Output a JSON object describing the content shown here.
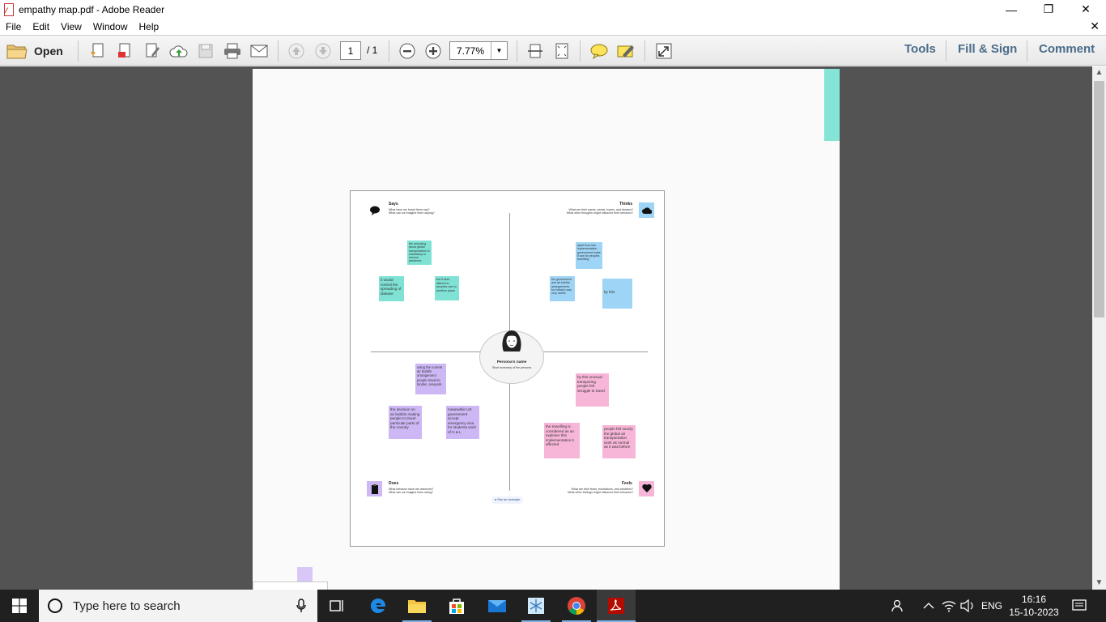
{
  "window": {
    "title": "empathy map.pdf - Adobe Reader",
    "minimize": "—",
    "restore": "❐",
    "close": "✕"
  },
  "menu": {
    "items": [
      "File",
      "Edit",
      "View",
      "Window",
      "Help"
    ],
    "close_doc": "✕"
  },
  "toolbar": {
    "open_label": "Open",
    "page_current": "1",
    "page_total": "/ 1",
    "zoom_value": "7.77%",
    "tools_label": "Tools",
    "fillsign_label": "Fill & Sign",
    "comment_label": "Comment"
  },
  "empathy_map": {
    "says": {
      "title": "Says",
      "subtitle": "What have we heard them say?\nWhat can we imagine them saying?"
    },
    "thinks": {
      "title": "Thinks",
      "subtitle": "What are their wants, needs, hopes, and dreams?\nWhat other thoughts might influence their behavior?"
    },
    "does": {
      "title": "Does",
      "subtitle": "What behavior have we observed?\nWhat can we imagine them doing?"
    },
    "feels": {
      "title": "Feels",
      "subtitle": "What are their fears, frustrations, and anxieties?\nWhat other feelings might influence their behavior?"
    },
    "persona_name": "Persona's name",
    "persona_summary": "Short summary of the persona",
    "see_example": "See an example",
    "notes": {
      "says_1": "the unlocking about global transportation is mandatory to remove pandemic",
      "says_2": "it would control the spreading of disease",
      "says_3": "but it also affect the peoples use to another place",
      "thinks_1": "apart from this implementation government make it use for peoples travelling",
      "thinks_2": "the government and air bubble arrangements for Indian's was very useful",
      "thinks_3": "by this",
      "does_1": "using the current air bubble arrangement people travel to london ,newyork",
      "does_2": "the decision on air bubble making people to travel particular parts of the country",
      "does_3": "meanwhile US government accept emergency visa for students work of H & L",
      "feels_1": "by this unusual transporing people felt struggle to travel",
      "feels_2": "the travelling is considered as an exploser this implementation it affected",
      "feels_3": "people felt soonly the global air transportation work as normal as it was before"
    }
  },
  "taskbar": {
    "search_placeholder": "Type here to search",
    "lang": "ENG",
    "time": "16:16",
    "date": "15-10-2023"
  },
  "colors": {
    "teal": "#7fe2d4",
    "blue": "#9ed4f5",
    "purple": "#cdb8f5",
    "pink": "#f7b6d7",
    "workspace": "#535353",
    "taskbar": "#202020"
  }
}
